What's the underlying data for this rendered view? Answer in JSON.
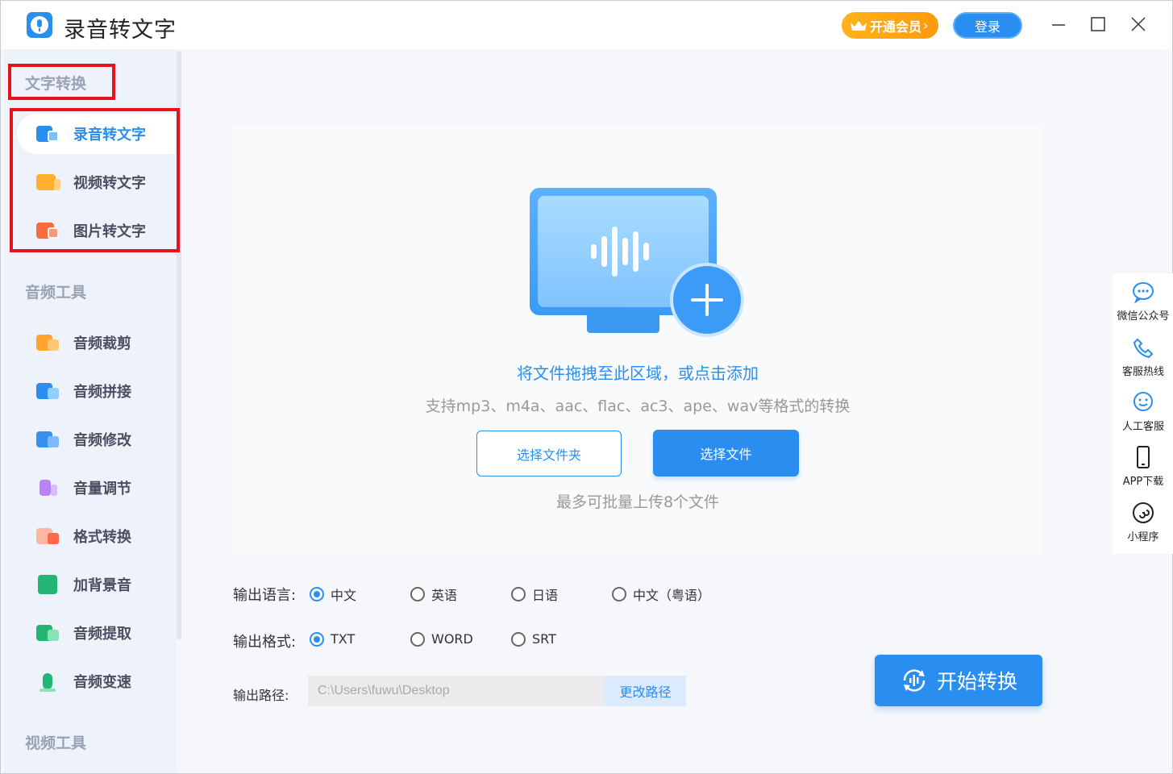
{
  "app": {
    "title": "录音转文字"
  },
  "header": {
    "vip_label": "开通会员",
    "vip_chevron": "›",
    "login_label": "登录"
  },
  "sidebar": {
    "section_text": "文字转换",
    "text_items": [
      {
        "label": "录音转文字",
        "icon": "mic-text-icon",
        "active": true
      },
      {
        "label": "视频转文字",
        "icon": "video-text-icon"
      },
      {
        "label": "图片转文字",
        "icon": "image-text-icon"
      }
    ],
    "section_audio": "音频工具",
    "audio_items": [
      {
        "label": "音频裁剪",
        "icon": "audio-cut-icon"
      },
      {
        "label": "音频拼接",
        "icon": "audio-join-icon"
      },
      {
        "label": "音频修改",
        "icon": "audio-edit-icon"
      },
      {
        "label": "音量调节",
        "icon": "volume-icon"
      },
      {
        "label": "格式转换",
        "icon": "format-convert-icon"
      },
      {
        "label": "加背景音",
        "icon": "music-note-icon"
      },
      {
        "label": "音频提取",
        "icon": "audio-extract-icon"
      },
      {
        "label": "音频变速",
        "icon": "audio-speed-icon"
      }
    ],
    "section_video": "视频工具"
  },
  "dropzone": {
    "title": "将文件拖拽至此区域，或点击添加",
    "formats": "支持mp3、m4a、aac、flac、ac3、ape、wav等格式的转换",
    "btn_folder": "选择文件夹",
    "btn_file": "选择文件",
    "batch_note": "最多可批量上传8个文件"
  },
  "options": {
    "language_label": "输出语言:",
    "languages": [
      "中文",
      "英语",
      "日语",
      "中文（粤语）"
    ],
    "language_selected": "中文",
    "format_label": "输出格式:",
    "formats": [
      "TXT",
      "WORD",
      "SRT"
    ],
    "format_selected": "TXT",
    "path_label": "输出路径:",
    "path_value": "C:\\Users\\fuwu\\Desktop",
    "path_button": "更改路径",
    "start_button": "开始转换"
  },
  "right_panel": [
    {
      "label": "微信公众号",
      "icon": "wechat-icon"
    },
    {
      "label": "客服热线",
      "icon": "phone-icon"
    },
    {
      "label": "人工客服",
      "icon": "support-icon"
    },
    {
      "label": "APP下载",
      "icon": "mobile-icon"
    },
    {
      "label": "小程序",
      "icon": "mini-program-icon"
    }
  ],
  "colors": {
    "accent": "#2a8ef0",
    "vip": "#ffa812",
    "highlight": "#e8121a"
  }
}
